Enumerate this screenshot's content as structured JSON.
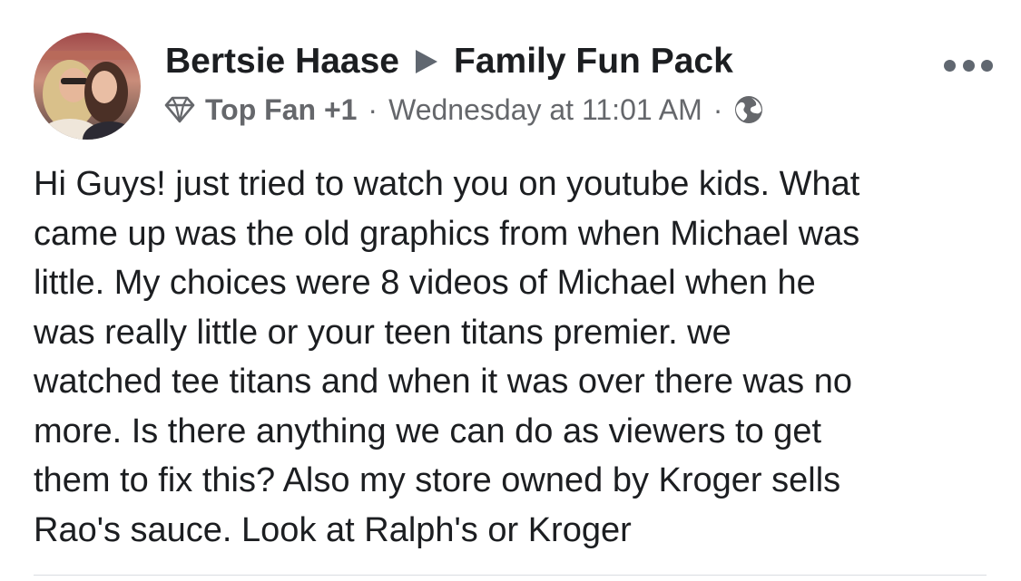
{
  "post": {
    "author": "Bertsie Haase",
    "group": "Family Fun Pack",
    "badge": "Top Fan +1",
    "separator": "·",
    "timestamp": "Wednesday at 11:01 AM",
    "icons": {
      "badge_icon": "diamond-icon",
      "privacy_icon": "globe-icon",
      "arrow_icon": "triangle-right-icon",
      "more_icon": "more-options-icon"
    },
    "body_lines": [
      "Hi Guys! just tried to watch you on youtube kids. What",
      "came up was the old graphics from when Michael was",
      "little. My choices were 8 videos of Michael when he",
      "was really little or your teen titans premier. we",
      "watched tee titans and when it was over there was no",
      "more. Is there anything we can do as viewers to get",
      "them to fix this? Also my store owned by Kroger sells",
      "Rao's sauce. Look at Ralph's or Kroger"
    ]
  },
  "colors": {
    "primary_text": "#1c1e21",
    "secondary_text": "#65676b",
    "icon_gray": "#606770",
    "divider": "#dadde1",
    "background": "#ffffff"
  }
}
